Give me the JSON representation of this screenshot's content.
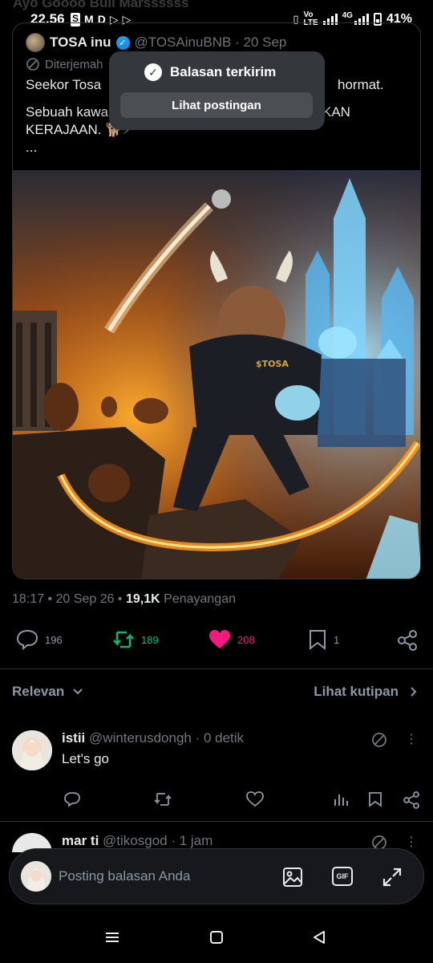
{
  "status_bar": {
    "time": "22.56",
    "left_icons": [
      "S",
      "M",
      "D",
      "▷",
      "▷"
    ],
    "network_small": "Vo\nLTE",
    "net_type": "4G",
    "battery": "41%"
  },
  "ghost_header": "Ayo Goooo Bull Marssssss",
  "quoted_post": {
    "author_name": "TOSA inu",
    "handle_date": "@TOSAinuBNB · 20 Sep",
    "translated_label": "Diterjemah",
    "line1": "Seekor Tosa",
    "line1_end": "hormat.",
    "line2a": "Sebuah kawa",
    "line2b": "KAN",
    "line3": "KERAJAAN. 🐕⚡",
    "ellipsis": "...",
    "image_caption": "$TOSA"
  },
  "toast": {
    "title": "Balasan terkirim",
    "button": "Lihat postingan"
  },
  "meta": {
    "time_date": "18:17 • 20 Sep 26 • ",
    "views": "19,1K",
    "views_label": "Penayangan"
  },
  "actions": {
    "replies": "196",
    "reposts": "189",
    "likes": "208",
    "bookmarks": "1",
    "repost_color": "#00ba7c",
    "like_color": "#f91880"
  },
  "sort": {
    "left": "Relevan",
    "right": "Lihat kutipan"
  },
  "replies": [
    {
      "name": "istii",
      "handle_time": "@winterusdongh · 0 detik",
      "text": "Let's go"
    },
    {
      "name": "mar ti",
      "handle_time": "@tikosgod · 1 jam",
      "text": ""
    }
  ],
  "composer": {
    "placeholder": "Posting balasan Anda",
    "gif_label": "GIF"
  }
}
